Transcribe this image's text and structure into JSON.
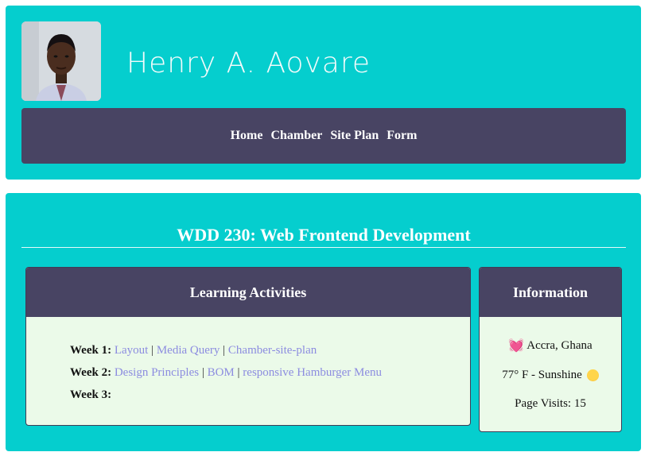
{
  "header": {
    "name": "Henry A. Aovare",
    "nav": [
      "Home",
      "Chamber",
      "Site Plan",
      "Form"
    ]
  },
  "main": {
    "course_title": "WDD 230: Web Frontend Development",
    "activities": {
      "title": "Learning Activities",
      "weeks": [
        {
          "label": "Week 1:",
          "links": [
            "Layout",
            "Media Query",
            "Chamber-site-plan"
          ]
        },
        {
          "label": "Week 2:",
          "links": [
            "Design Principles",
            "BOM",
            "responsive Hamburger Menu"
          ]
        },
        {
          "label": "Week 3:",
          "links": []
        }
      ]
    },
    "info": {
      "title": "Information",
      "location": "Accra, Ghana",
      "weather": "77° F - Sunshine",
      "visits": "Page Visits: 15"
    }
  },
  "icons": {
    "location": "heart-icon",
    "weather": "sun-icon"
  },
  "colors": {
    "card_bg": "#05cece",
    "nav_bg": "#484463",
    "panel_bg": "#ebfae9",
    "link": "#8c8ce0"
  }
}
